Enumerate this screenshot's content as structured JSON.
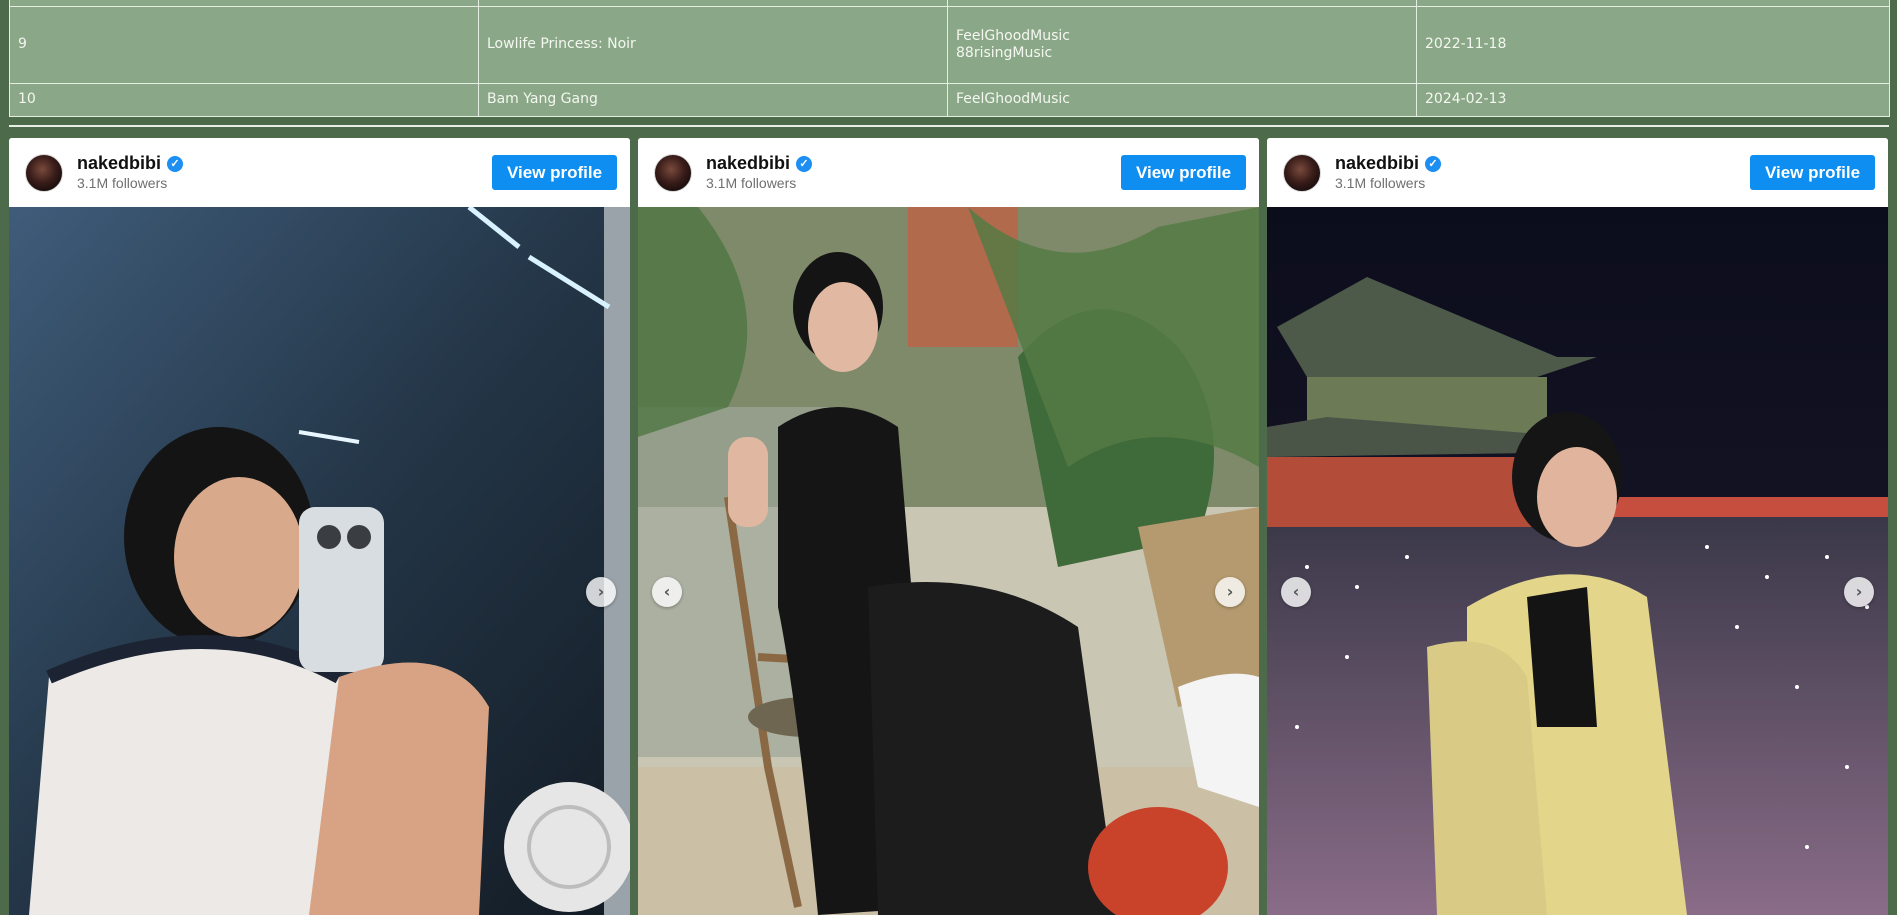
{
  "table": {
    "rows": [
      {
        "rank": "9",
        "title": "Lowlife Princess: Noir",
        "artists": [
          "FeelGhoodMusic",
          "88risingMusic"
        ],
        "date": "2022-11-18"
      },
      {
        "rank": "10",
        "title": "Bam Yang Gang",
        "artists": [
          "FeelGhoodMusic"
        ],
        "date": "2024-02-13"
      }
    ]
  },
  "posts": [
    {
      "username": "nakedbibi",
      "followers": "3.1M followers",
      "button_label": "View profile"
    },
    {
      "username": "nakedbibi",
      "followers": "3.1M followers",
      "button_label": "View profile"
    },
    {
      "username": "nakedbibi",
      "followers": "3.1M followers",
      "button_label": "View profile"
    }
  ],
  "icons": {
    "verified": "verified-badge-icon",
    "next": "chevron-right-icon",
    "prev": "chevron-left-icon"
  },
  "colors": {
    "page_background": "#4d6b4a",
    "table_background": "#8aa888",
    "button_blue": "#0d8ef0",
    "verified_blue": "#1d8ff2"
  }
}
